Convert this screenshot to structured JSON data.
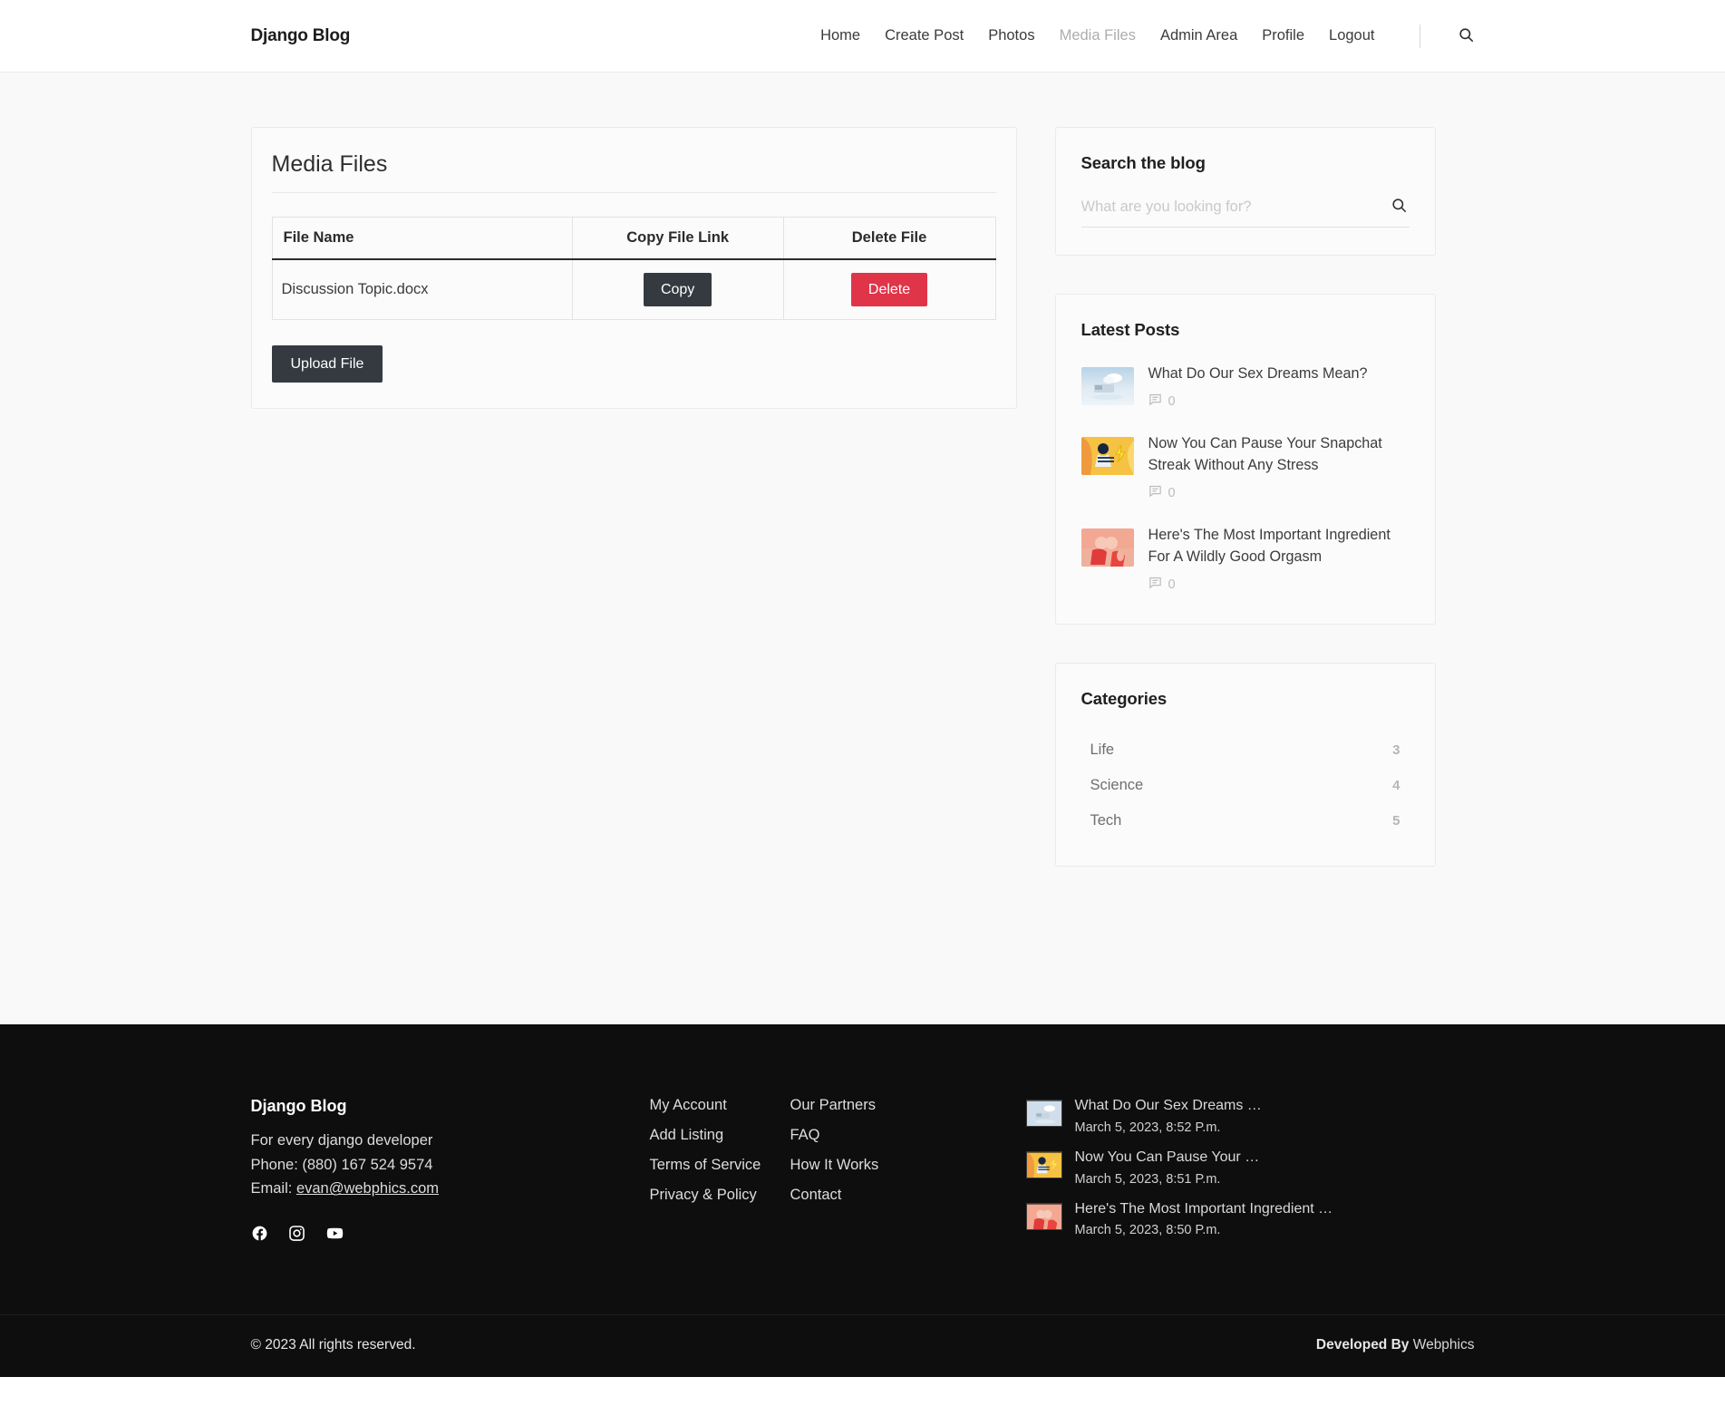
{
  "navbar": {
    "brand": "Django Blog",
    "links": [
      {
        "label": "Home",
        "active": false
      },
      {
        "label": "Create Post",
        "active": false
      },
      {
        "label": "Photos",
        "active": false
      },
      {
        "label": "Media Files",
        "active": true
      },
      {
        "label": "Admin Area",
        "active": false
      },
      {
        "label": "Profile",
        "active": false
      },
      {
        "label": "Logout",
        "active": false
      }
    ],
    "search_icon": "search-icon"
  },
  "main": {
    "panel_title": "Media Files",
    "table": {
      "headers": [
        "File Name",
        "Copy File Link",
        "Delete File"
      ],
      "rows": [
        {
          "file_name": "Discussion Topic.docx",
          "copy_label": "Copy",
          "delete_label": "Delete"
        }
      ]
    },
    "upload_label": "Upload File"
  },
  "sidebar": {
    "search": {
      "title": "Search the blog",
      "placeholder": "What are you looking for?",
      "value": "",
      "icon": "search-icon"
    },
    "latest_posts": {
      "title": "Latest Posts",
      "items": [
        {
          "title": "What Do Our Sex Dreams Mean?",
          "comments": "0"
        },
        {
          "title": "Now You Can Pause Your Snapchat Streak Without Any Stress",
          "comments": "0"
        },
        {
          "title": "Here's The Most Important Ingredient For A Wildly Good Orgasm",
          "comments": "0"
        }
      ]
    },
    "categories": {
      "title": "Categories",
      "items": [
        {
          "name": "Life",
          "count": "3"
        },
        {
          "name": "Science",
          "count": "4"
        },
        {
          "name": "Tech",
          "count": "5"
        }
      ]
    }
  },
  "footer": {
    "brand": {
      "title": "Django Blog",
      "tagline": "For every django developer",
      "phone": "Phone: (880) 167 524 9574",
      "email_label": "Email:",
      "email": "evan@webphics.com"
    },
    "socials": [
      "facebook-icon",
      "instagram-icon",
      "youtube-icon"
    ],
    "links_col1": [
      "My Account",
      "Add Listing",
      "Terms of Service",
      "Privacy & Policy"
    ],
    "links_col2": [
      "Our Partners",
      "FAQ",
      "How It Works",
      "Contact"
    ],
    "recent_posts": [
      {
        "title": "What Do Our Sex Dreams …",
        "date": "March 5, 2023, 8:52 P.m."
      },
      {
        "title": "Now You Can Pause Your …",
        "date": "March 5, 2023, 8:51 P.m."
      },
      {
        "title": "Here's The Most Important Ingredient …",
        "date": "March 5, 2023, 8:50 P.m."
      }
    ],
    "copyright": "© 2023 All rights reserved.",
    "developed_by": "Developed By",
    "developer": "Webphics"
  },
  "colors": {
    "accent_dark": "#343a40",
    "danger": "#e03449",
    "page_bg": "#f9f9f9",
    "footer_bg": "#0e0e0e"
  }
}
